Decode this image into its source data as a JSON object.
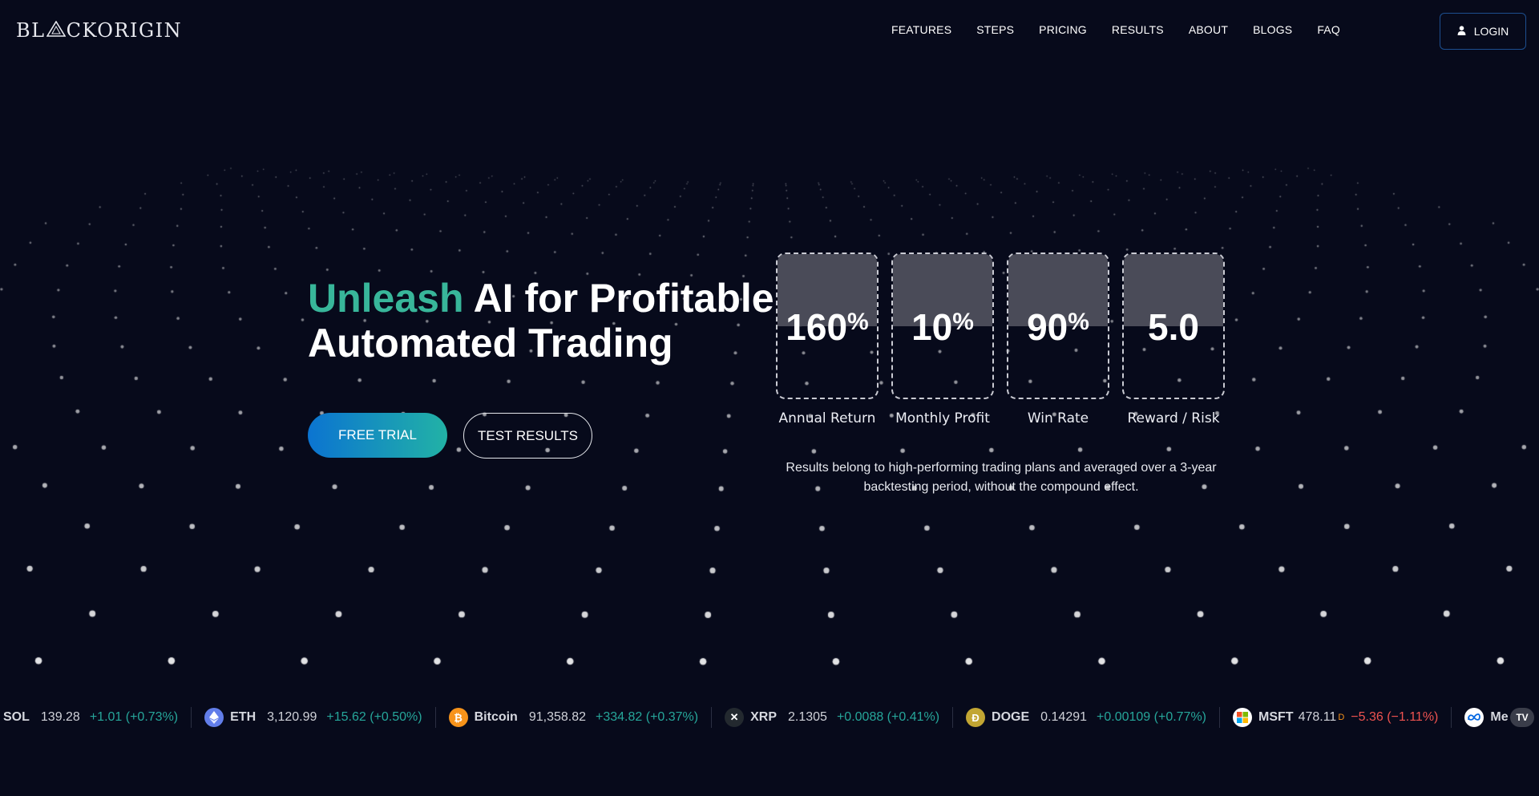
{
  "brand": {
    "logo_text_left": "BL",
    "logo_text_right": "CKORIGIN"
  },
  "nav": {
    "items": [
      "FEATURES",
      "STEPS",
      "PRICING",
      "RESULTS",
      "ABOUT",
      "BLOGS",
      "FAQ"
    ],
    "login_label": "LOGIN"
  },
  "hero": {
    "title_accent": "Unleash",
    "title_rest": "AI for Profitable",
    "title_line2": "Automated Trading",
    "free_trial_label": "FREE TRIAL",
    "test_results_label": "TEST RESULTS"
  },
  "stats": [
    {
      "value": "160",
      "suffix": "%",
      "label": "Annual Return"
    },
    {
      "value": "10",
      "suffix": "%",
      "label": "Monthly Profit"
    },
    {
      "value": "90",
      "suffix": "%",
      "label": "Win Rate"
    },
    {
      "value": "5.0",
      "suffix": "",
      "label": "Reward / Risk"
    }
  ],
  "disclaimer": "Results belong to high-performing trading plans and averaged over a 3-year backtesting period, without the compound effect.",
  "ticker": [
    {
      "symbol": "SOL",
      "price": "139.28",
      "change": "+1.01 (+0.73%)",
      "direction": "up",
      "icon": "solana-icon",
      "icon_color": "#070a1b"
    },
    {
      "symbol": "ETH",
      "price": "3,120.99",
      "change": "+15.62 (+0.50%)",
      "direction": "up",
      "icon": "ethereum-icon",
      "icon_color": "#627eea"
    },
    {
      "symbol": "Bitcoin",
      "price": "91,358.82",
      "change": "+334.82 (+0.37%)",
      "direction": "up",
      "icon": "bitcoin-icon",
      "icon_color": "#f7931a"
    },
    {
      "symbol": "XRP",
      "price": "2.1305",
      "change": "+0.0088 (+0.41%)",
      "direction": "up",
      "icon": "xrp-icon",
      "icon_color": "#23292f"
    },
    {
      "symbol": "DOGE",
      "price": "0.14291",
      "change": "+0.00109 (+0.77%)",
      "direction": "up",
      "icon": "dogecoin-icon",
      "icon_color": "#c2a633"
    },
    {
      "symbol": "MSFT",
      "price": "478.11",
      "change": "−5.36 (−1.11%)",
      "direction": "down",
      "icon": "microsoft-icon",
      "icon_color": "#ffffff",
      "market_flag": "D"
    },
    {
      "symbol": "Me",
      "price": "",
      "change": "",
      "direction": "up",
      "icon": "meta-icon",
      "icon_color": "#ffffff"
    }
  ],
  "tradingview_badge": "TV",
  "colors": {
    "background": "#070a1b",
    "accent": "#38b69a",
    "up": "#26a69a",
    "down": "#ef5350"
  }
}
